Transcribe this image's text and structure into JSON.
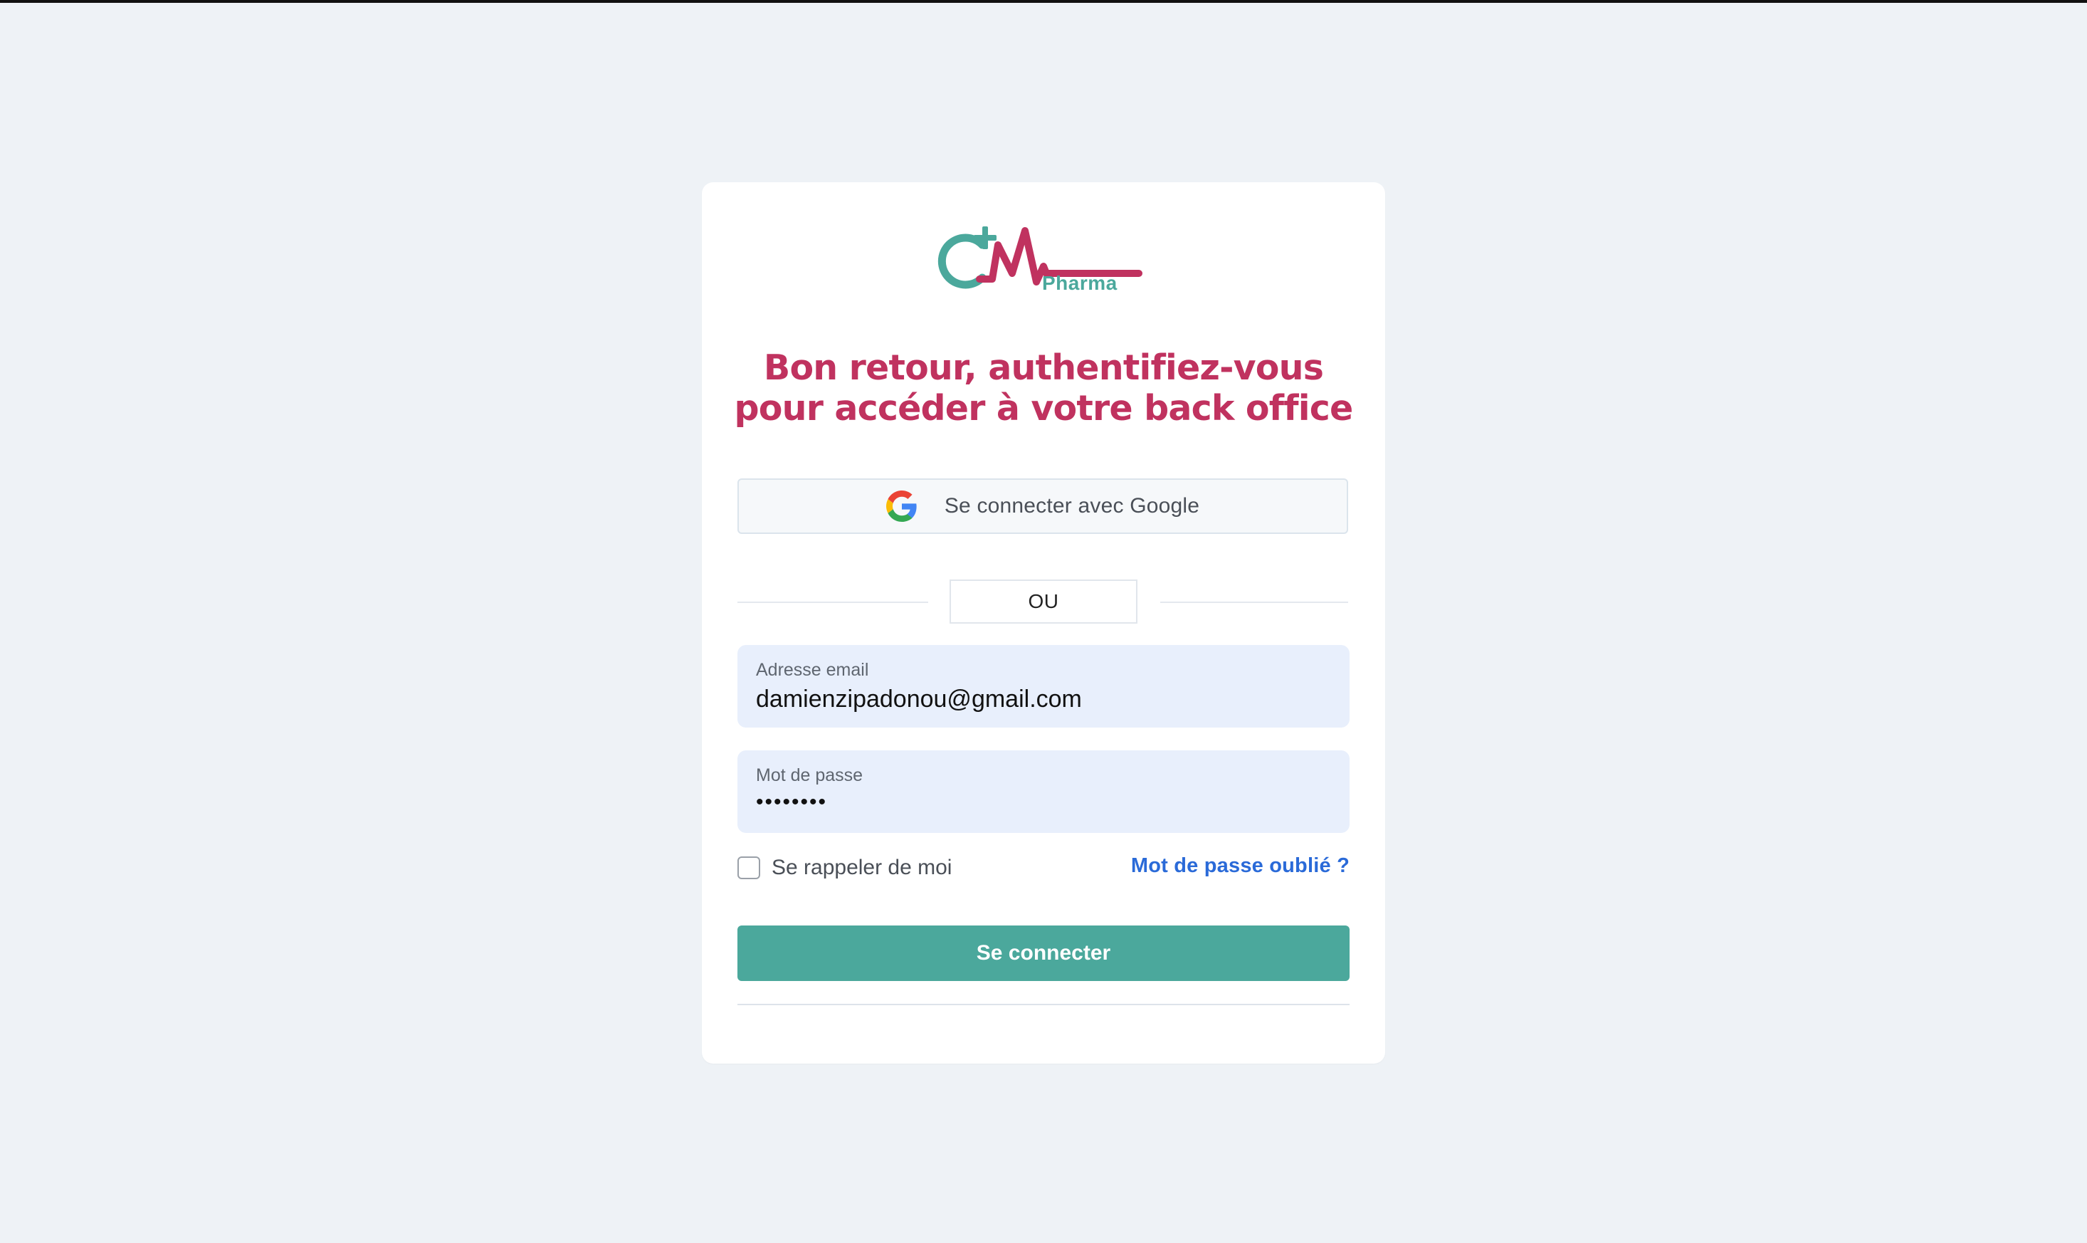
{
  "logo": {
    "wordmark": "Pharma",
    "colors": {
      "teal": "#4ba89c",
      "magenta": "#c0325f"
    }
  },
  "headline": "Bon retour, authentifiez-vous pour accéder à votre back office",
  "google_button": {
    "label": "Se connecter avec Google",
    "icon": "google-icon"
  },
  "divider_label": "OU",
  "email_field": {
    "label": "Adresse email",
    "value": "damienzipadonou@gmail.com"
  },
  "password_field": {
    "label": "Mot de passe",
    "value": "••••••••"
  },
  "remember_me": {
    "label": "Se rappeler de moi",
    "checked": false
  },
  "forgot_password_label": "Mot de passe oublié ?",
  "submit_label": "Se connecter",
  "colors": {
    "page_background": "#eef2f6",
    "brand_teal": "#4ba89c",
    "headline_magenta": "#c0325f",
    "link_blue": "#2a6ad8",
    "field_background": "#e8effc"
  }
}
